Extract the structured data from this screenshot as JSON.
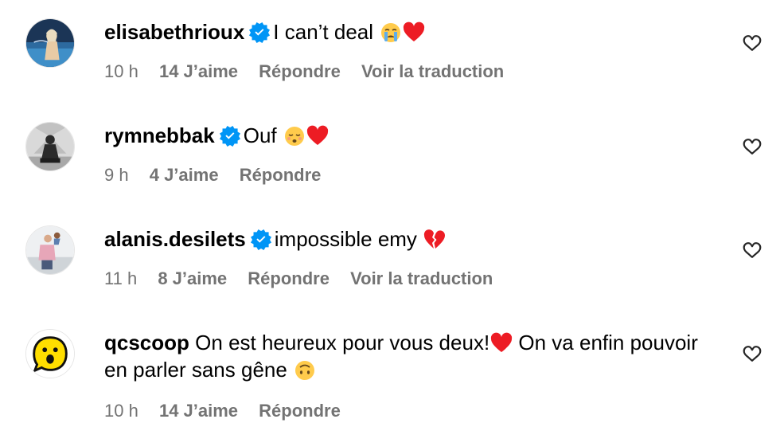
{
  "comments": [
    {
      "username": "elisabethrioux",
      "text": "I can’t deal",
      "emojis": [
        "crying-face",
        "red-heart"
      ],
      "time": "10 h",
      "likes": "14 J’aime",
      "reply": "Répondre",
      "translate": "Voir la traduction"
    },
    {
      "username": "rymnebbak",
      "text": "Ouf",
      "emojis": [
        "sad-face",
        "red-heart"
      ],
      "time": "9 h",
      "likes": "4 J’aime",
      "reply": "Répondre"
    },
    {
      "username": "alanis.desilets",
      "text": "impossible emy",
      "emojis": [
        "broken-heart"
      ],
      "time": "11 h",
      "likes": "8 J’aime",
      "reply": "Répondre",
      "translate": "Voir la traduction"
    },
    {
      "username": "qcscoop",
      "text_part1": "On est heureux pour vous deux!",
      "text_part2": " On va enfin pouvoir en parler sans gêne ",
      "emojis": [
        "red-heart",
        "upside-down-face"
      ],
      "time": "10 h",
      "likes": "14 J’aime",
      "reply": "Répondre"
    }
  ],
  "colors": {
    "meta_text": "#737373",
    "verified_badge": "#0095f6",
    "heart_red": "#ed1c24",
    "qcscoop_avatar_yellow": "#ffde00"
  }
}
